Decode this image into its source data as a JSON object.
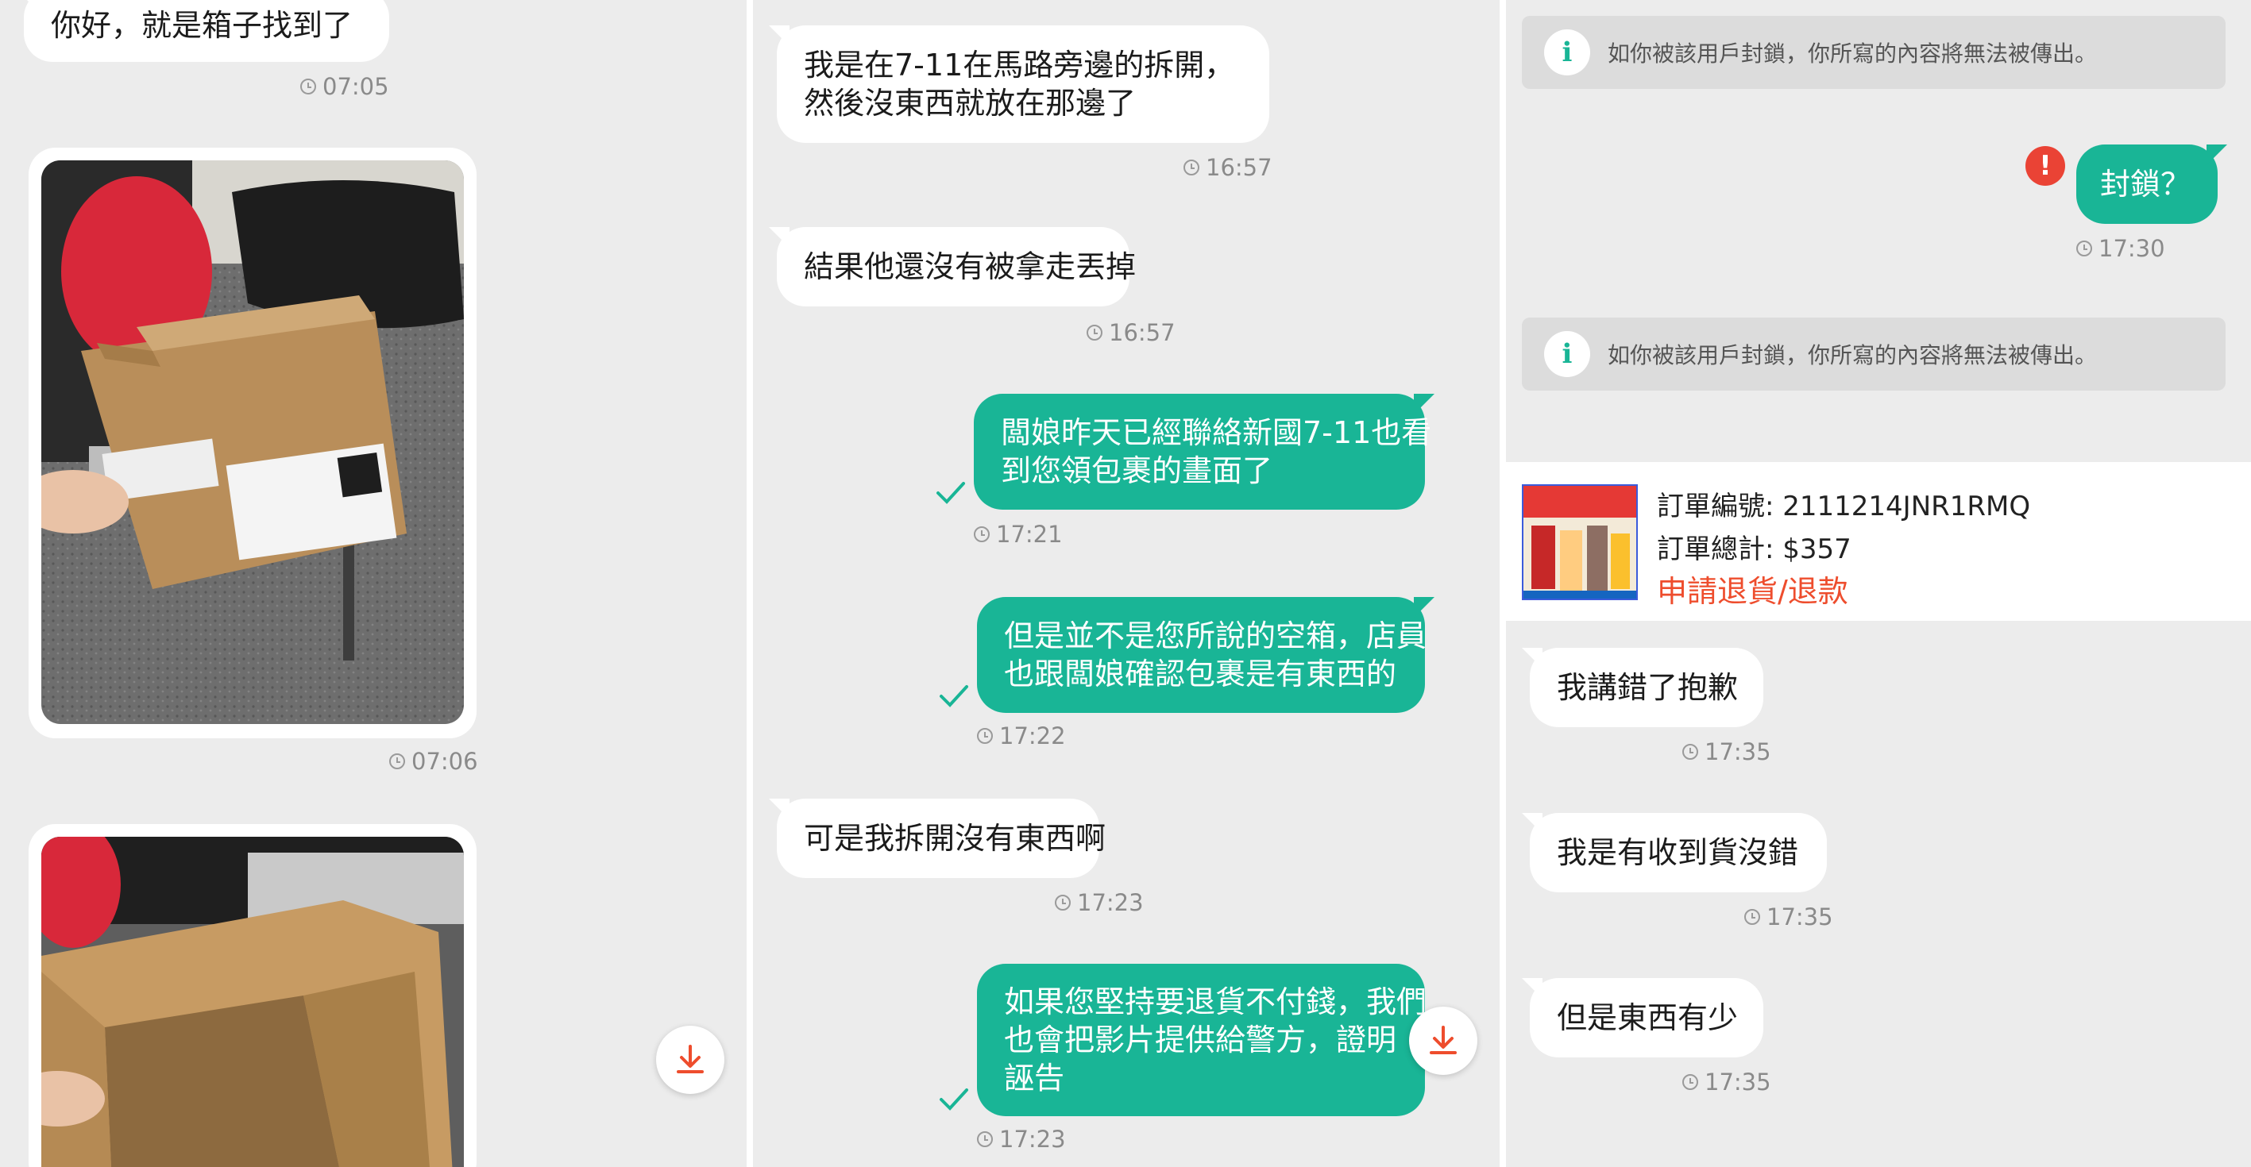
{
  "panel1": {
    "messages": [
      {
        "text": "你好，就是箱子找到了",
        "time": "07:05"
      },
      {
        "time": "07:06"
      }
    ]
  },
  "panel2": {
    "messages": [
      {
        "lines": [
          "我是在7-11在馬路旁邊的拆開，",
          "然後沒東西就放在那邊了"
        ],
        "time": "16:57"
      },
      {
        "text": "結果他還沒有被拿走丟掉",
        "time": "16:57"
      },
      {
        "lines": [
          "闆娘昨天已經聯絡新國7-11也看",
          "到您領包裹的畫面了"
        ],
        "time": "17:21"
      },
      {
        "lines": [
          "但是並不是您所說的空箱，店員",
          "也跟闆娘確認包裹是有東西的"
        ],
        "time": "17:22"
      },
      {
        "text": "可是我拆開沒有東西啊",
        "time": "17:23"
      },
      {
        "lines": [
          "如果您堅持要退貨不付錢，我們",
          "也會把影片提供給警方，證明",
          "誣告"
        ],
        "time": "17:23"
      }
    ]
  },
  "panel3": {
    "notice_text": "如你被該用戶封鎖，你所寫的內容將無法被傳出。",
    "blocked_message": {
      "text": "封鎖？",
      "time": "17:30"
    },
    "order": {
      "id_label": "訂單編號: 2111214JNR1RMQ",
      "total_label": "訂單總計: $357",
      "action": "申請退貨/退款"
    },
    "messages": [
      {
        "text": "我講錯了抱歉",
        "time": "17:35"
      },
      {
        "text": "我是有收到貨沒錯",
        "time": "17:35"
      },
      {
        "text": "但是東西有少",
        "time": "17:35"
      }
    ]
  },
  "colors": {
    "background": "#ececec",
    "outgoing_bubble": "#19b596",
    "incoming_bubble": "#ffffff",
    "link": "#ee4d2d",
    "alert": "#ea4335"
  },
  "icons": [
    "clock-icon",
    "check-icon",
    "download-icon",
    "info-icon",
    "alert-icon"
  ]
}
